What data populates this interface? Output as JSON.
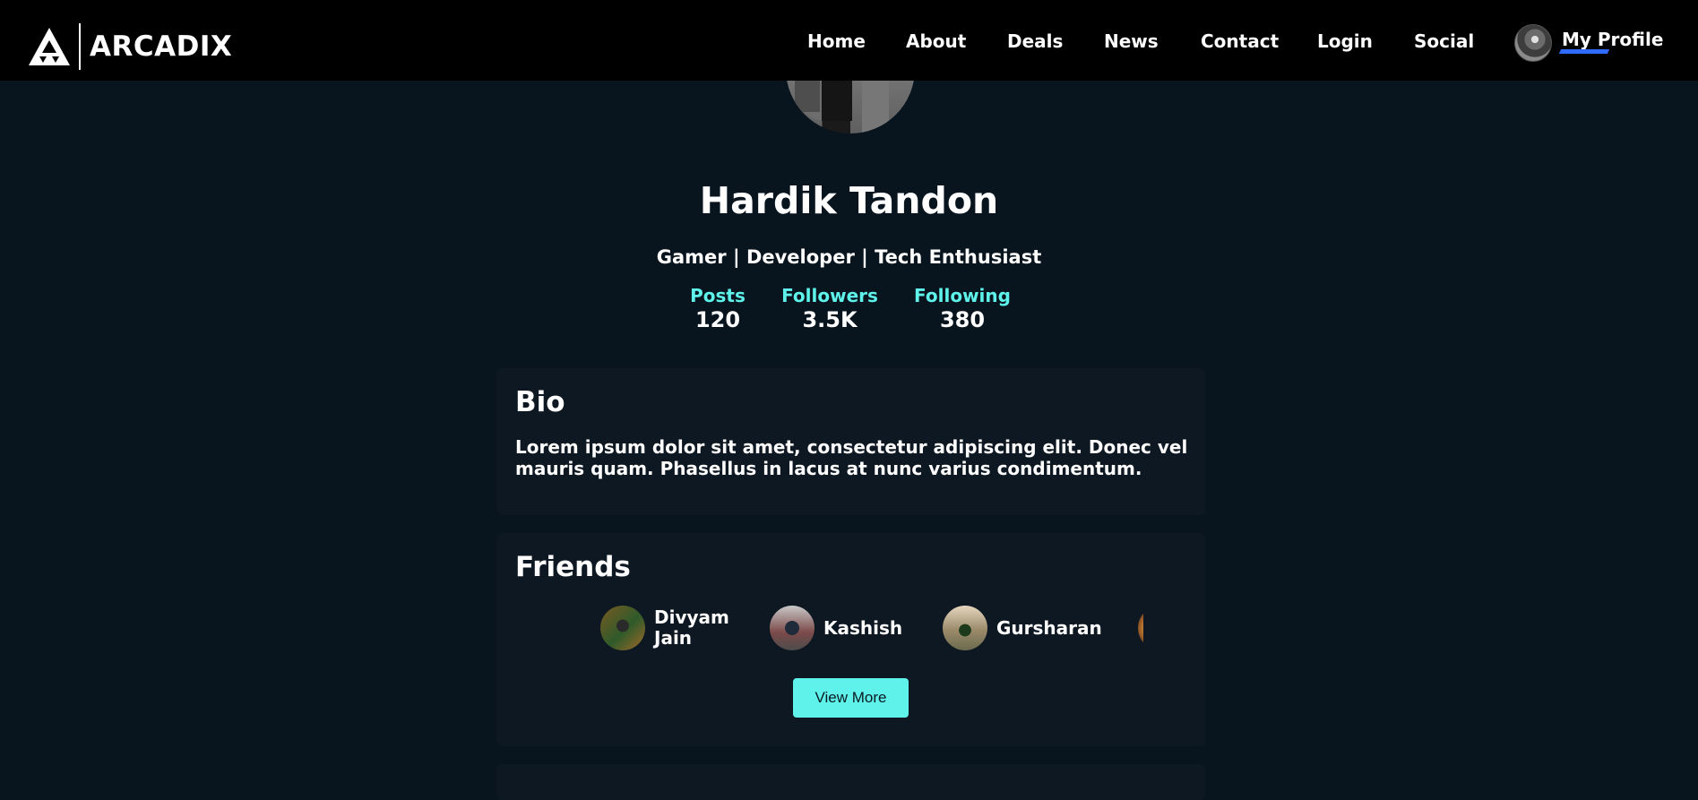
{
  "brand": {
    "logo_text": "ARCADIX"
  },
  "nav": {
    "links": [
      "Home",
      "About",
      "Deals",
      "News",
      "Contact",
      "Login",
      "Social"
    ],
    "profile_label": "My Profile"
  },
  "profile": {
    "name": "Hardik Tandon",
    "tagline": "Gamer | Developer | Tech Enthusiast",
    "stats": [
      {
        "label": "Posts",
        "value": "120"
      },
      {
        "label": "Followers",
        "value": "3.5K"
      },
      {
        "label": "Following",
        "value": "380"
      }
    ]
  },
  "bio": {
    "title": "Bio",
    "text": "Lorem ipsum dolor sit amet, consectetur adipiscing elit. Donec vel mauris quam. Phasellus in lacus at nunc varius condimentum."
  },
  "friends": {
    "title": "Friends",
    "items": [
      {
        "name": "Divyam Jain"
      },
      {
        "name": "Kashish"
      },
      {
        "name": "Gursharan"
      }
    ],
    "view_more_label": "View More"
  },
  "colors": {
    "accent": "#5ef2ea",
    "background": "#08141e",
    "card": "#0e1822",
    "navbar": "#000000",
    "underline": "#2f6bff"
  }
}
